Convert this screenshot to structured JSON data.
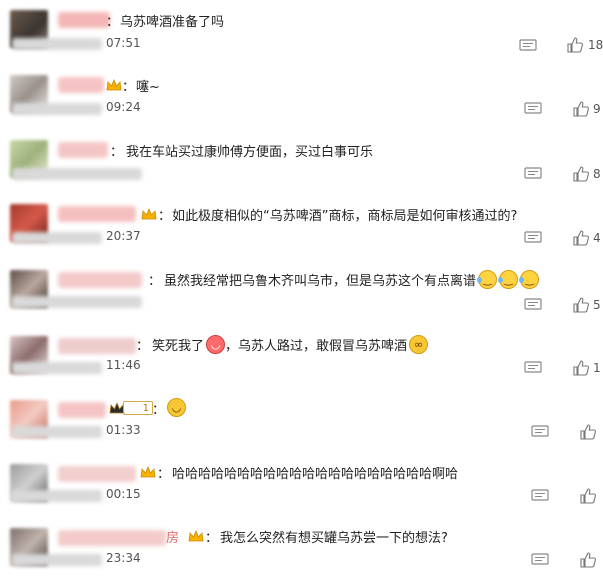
{
  "comments": [
    {
      "text": "乌苏啤酒准备了吗",
      "time": "07:51",
      "likes": "18"
    },
    {
      "text": "噻~",
      "time": "09:24",
      "likes": "9"
    },
    {
      "text": "我在车站买过康帅傅方便面，买过白事可乐",
      "time": "",
      "likes": "8"
    },
    {
      "text": "如此极度相似的“乌苏啤酒”商标，商标局是如何审核通过的?",
      "time": "20:37",
      "likes": "4"
    },
    {
      "text": "虽然我经常把乌鲁木齐叫乌市，但是乌苏这个有点离谱",
      "time": "",
      "likes": "5"
    },
    {
      "text": "笑死我了",
      "text2": "，乌苏人路过，敢假冒乌苏啤酒",
      "time": "11:46",
      "likes": "1"
    },
    {
      "text": "",
      "time": "01:33",
      "likes": "",
      "level": "1"
    },
    {
      "text": "哈哈哈哈哈哈哈哈哈哈哈哈哈哈哈哈哈哈哈哈啊哈",
      "time": "00:15",
      "likes": ""
    },
    {
      "text": "我怎么突然有想买罐乌苏尝一下的想法?",
      "time": "23:34",
      "likes": ""
    }
  ],
  "name_fragments": {
    "row9": "房"
  },
  "icons": {
    "reply": "reply-icon",
    "like": "thumbs-up-icon",
    "crown": "crown-icon"
  },
  "colors": {
    "crown": "#f5b100",
    "text": "#222222",
    "meta": "#555555"
  }
}
